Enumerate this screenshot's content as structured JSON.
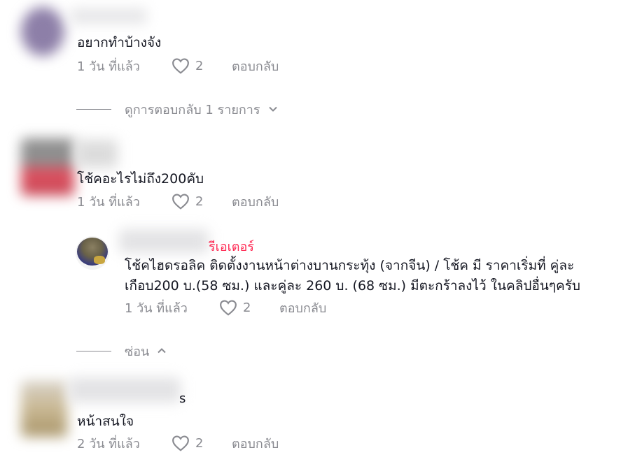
{
  "comments": [
    {
      "text": "อยากทำบ้างจัง",
      "time": "1 วัน ที่แล้ว",
      "likes": "2",
      "reply_label": "ตอบกลับ",
      "view_replies_label": "ดูการตอบกลับ 1 รายการ"
    },
    {
      "text": "โช้คอะไรไม่ถึง200คับ",
      "time": "1 วัน ที่แล้ว",
      "likes": "2",
      "reply_label": "ตอบกลับ",
      "hide_label": "ซ่อน",
      "reply": {
        "creator_suffix": "รีเอเตอร์",
        "text_line1": "โช้คไฮดรอลิค ติดตั้งงานหน้าต่างบานกระทุ้ง (จากจีน) / โช้ค มี ราคาเริ่มที่ คู่ละ",
        "text_line2": "เกือบ200 บ.(58 ซม.) และคู่ละ 260 บ. (68 ซม.) มีตะกร้าลงไว้ ในคลิปอื่นๆครับ",
        "time": "1 วัน ที่แล้ว",
        "likes": "2",
        "reply_label": "ตอบกลับ"
      }
    },
    {
      "username_tail": "s",
      "text": "หน้าสนใจ",
      "time": "2 วัน ที่แล้ว",
      "likes": "2",
      "reply_label": "ตอบกลับ"
    }
  ],
  "colors": {
    "text_primary": "#161823",
    "text_secondary": "#8a8b91",
    "creator_accent": "#fe2c55"
  },
  "icons": [
    "heart-outline-icon",
    "chevron-down-icon",
    "chevron-up-icon"
  ]
}
